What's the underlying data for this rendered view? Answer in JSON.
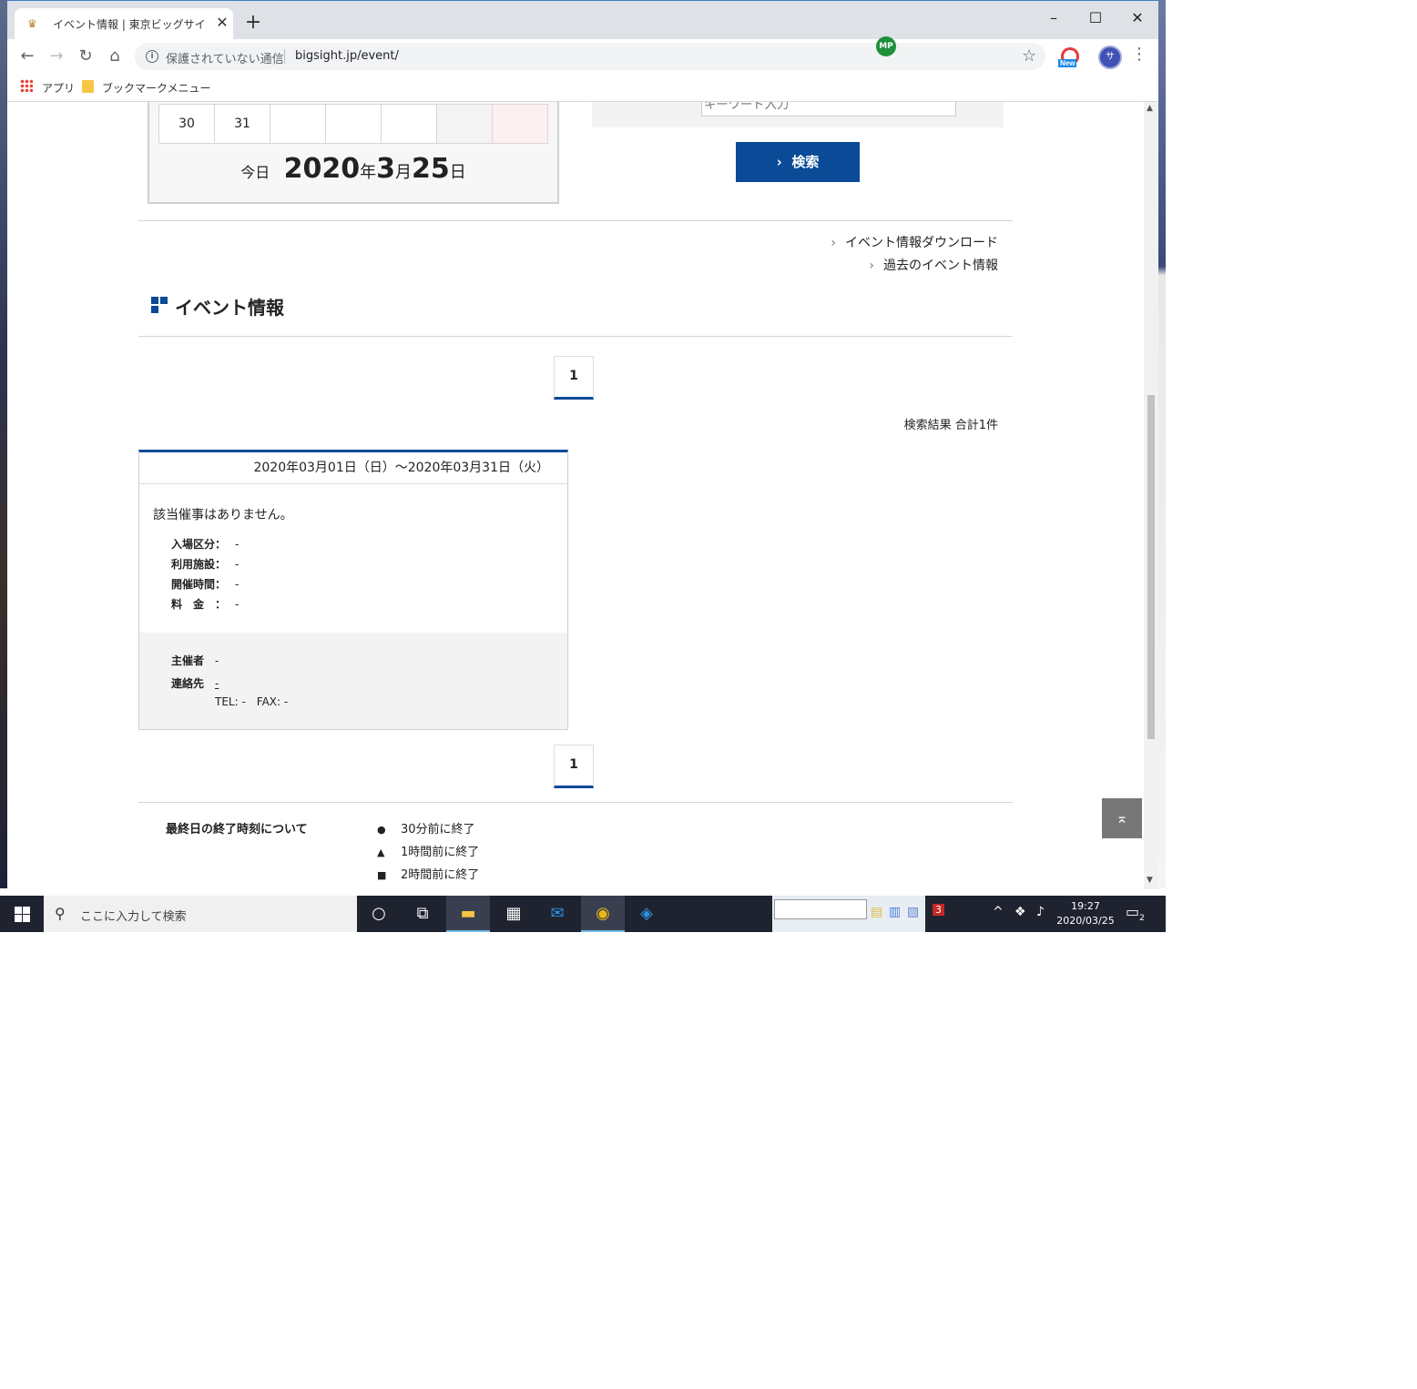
{
  "browser": {
    "tab_title": "イベント情報 | 東京ビッグサイト（東",
    "tab_close": "✕",
    "new_tab": "+",
    "security_label": "保護されていない通信",
    "url": "bigsight.jp/event/",
    "ext_badge": "MP",
    "ext_new_label": "New",
    "avatar_letter": "サ",
    "bookmarks": [
      {
        "label": "アプリ",
        "icon": "apps-icon"
      },
      {
        "label": "ブックマークメニュー",
        "icon": "folder-icon"
      }
    ]
  },
  "calendar": {
    "cells": [
      "30",
      "31",
      "",
      "",
      "",
      "",
      ""
    ],
    "today_label": "今日",
    "year": "2020",
    "year_suffix": "年",
    "month": "3",
    "month_suffix": "月",
    "day": "25",
    "day_suffix": "日"
  },
  "search": {
    "keyword_placeholder": "キーワード入力",
    "button_label": "検索",
    "button_arrow": "›"
  },
  "links": {
    "download": "イベント情報ダウンロード",
    "past": "過去のイベント情報",
    "chevron": "›"
  },
  "section": {
    "title": "イベント情報"
  },
  "pager": {
    "top_page": "1",
    "bottom_page": "1"
  },
  "results": {
    "count_text": "検索結果 合計1件"
  },
  "event_card": {
    "date_range": "2020年03月01日（日）～2020年03月31日（火）",
    "none_text": "該当催事はありません。",
    "fields": [
      {
        "label": "入場区分：",
        "value": "-"
      },
      {
        "label": "利用施設：",
        "value": "-"
      },
      {
        "label": "開催時間：",
        "value": "-"
      },
      {
        "label": "料　金　：",
        "value": "-"
      }
    ],
    "organizer_label": "主催者",
    "organizer_value": "-",
    "contact_label": "連絡先",
    "contact_value": "-",
    "tel_fax": "TEL: -　FAX: -"
  },
  "legend": {
    "title": "最終日の終了時刻について",
    "items": [
      {
        "symbol": "●",
        "text": "30分前に終了"
      },
      {
        "symbol": "▲",
        "text": "1時間前に終了"
      },
      {
        "symbol": "■",
        "text": "2時間前に終了"
      }
    ]
  },
  "page_top_icon": "⌅",
  "taskbar": {
    "search_placeholder": "ここに入力して検索",
    "time": "19:27",
    "date": "2020/03/25",
    "notif_count": "2",
    "tray_badge": "3"
  },
  "colors": {
    "brand_blue": "#0a4a96",
    "taskbar": "#1f2330"
  }
}
